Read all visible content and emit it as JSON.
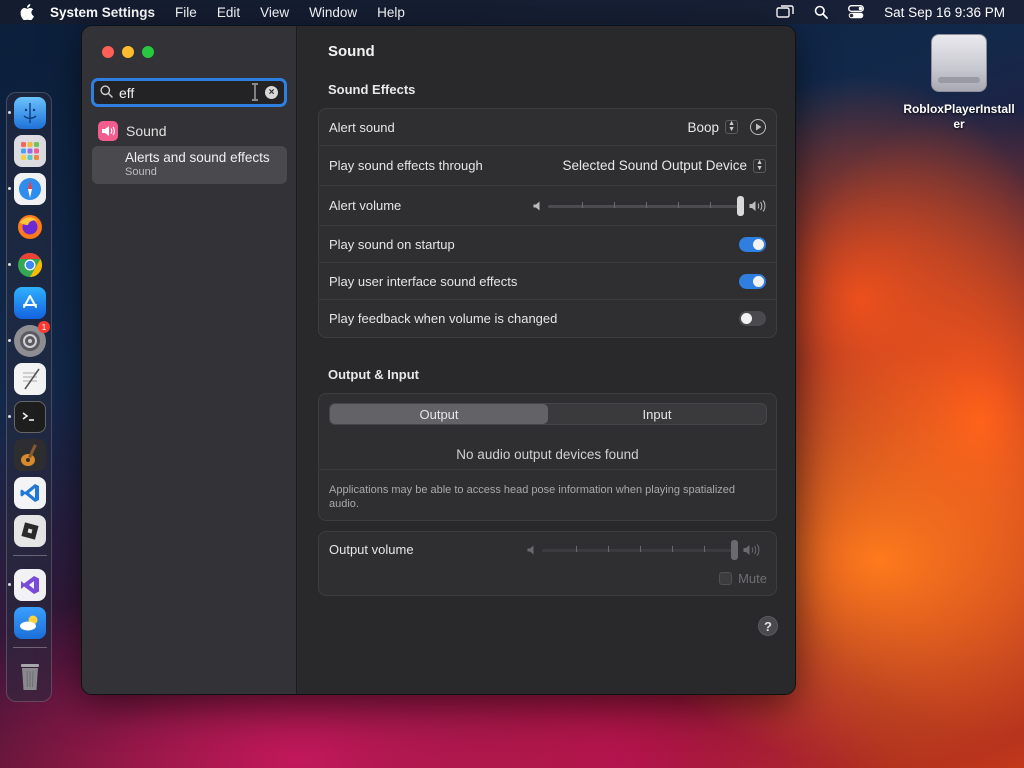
{
  "menubar": {
    "app_name": "System Settings",
    "menus": [
      "File",
      "Edit",
      "View",
      "Window",
      "Help"
    ],
    "clock": "Sat Sep 16  9:36 PM"
  },
  "dock": {
    "apps": [
      {
        "name": "finder-icon",
        "color": "#3a8ee6"
      },
      {
        "name": "launchpad-icon",
        "color": "#d8d8dc"
      },
      {
        "name": "safari-icon",
        "color": "#2d8ef0"
      },
      {
        "name": "firefox-icon",
        "color": "#ff7a1c"
      },
      {
        "name": "chrome-icon",
        "color": "#ffffff"
      },
      {
        "name": "app-store-icon",
        "color": "#1c7ff0"
      },
      {
        "name": "system-settings-icon",
        "color": "#8e8e93",
        "badge": "1"
      },
      {
        "name": "textedit-icon",
        "color": "#f2f2f2"
      },
      {
        "name": "terminal-icon",
        "color": "#1e1e1e"
      },
      {
        "name": "garageband-icon",
        "color": "#3a3a3a"
      },
      {
        "name": "vscode-icon",
        "color": "#1e7ad6"
      },
      {
        "name": "roblox-icon",
        "color": "#e6e6e6"
      },
      {
        "name": "visual-studio-icon",
        "color": "#7a4bd8"
      },
      {
        "name": "weather-icon",
        "color": "#2f8fe8"
      },
      {
        "name": "trash-icon",
        "color": "#8a8a8e"
      }
    ]
  },
  "desktop": {
    "icon_label": "RobloxPlayerInstaller"
  },
  "sidebar": {
    "search_value": "eff",
    "section_label": "Sound",
    "result_title": "Alerts and sound effects",
    "result_subtitle": "Sound"
  },
  "content": {
    "title": "Sound",
    "sound_effects": {
      "heading": "Sound Effects",
      "alert_sound_label": "Alert sound",
      "alert_sound_value": "Boop",
      "output_through_label": "Play sound effects through",
      "output_through_value": "Selected Sound Output Device",
      "alert_volume_label": "Alert volume",
      "alert_volume_level": 1.0,
      "startup_label": "Play sound on startup",
      "startup_on": true,
      "ui_effects_label": "Play user interface sound effects",
      "ui_effects_on": true,
      "feedback_label": "Play feedback when volume is changed",
      "feedback_on": false
    },
    "output_input": {
      "heading": "Output & Input",
      "tab_output": "Output",
      "tab_input": "Input",
      "empty_message": "No audio output devices found",
      "note": "Applications may be able to access head pose information when playing spatialized audio."
    },
    "output_volume": {
      "label": "Output volume",
      "level": 1.0,
      "mute_label": "Mute",
      "mute_checked": false
    },
    "help": "?"
  },
  "colors": {
    "accent": "#2f7fe0",
    "sound_icon": "#f25d8e"
  }
}
